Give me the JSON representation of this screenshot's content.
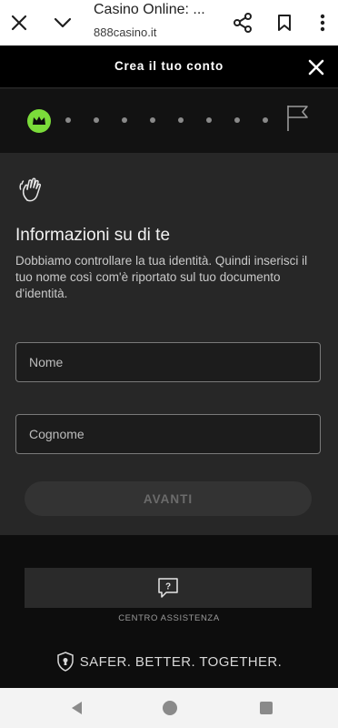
{
  "browser": {
    "title": "Casino Online: ...",
    "url": "888casino.it"
  },
  "dialog": {
    "title": "Crea il tuo conto"
  },
  "progress": {
    "total_steps": 9,
    "current_step": 1,
    "accent_color": "#7bdc3a"
  },
  "form": {
    "heading": "Informazioni su di te",
    "description": "Dobbiamo controllare la tua identità. Quindi inserisci il tuo nome così com'è riportato sul tuo documento d'identità.",
    "first_name": {
      "placeholder": "Nome",
      "value": ""
    },
    "last_name": {
      "placeholder": "Cognome",
      "value": ""
    },
    "submit_label": "AVANTI"
  },
  "footer": {
    "help_label": "CENTRO ASSISTENZA",
    "tagline": "SAFER. BETTER. TOGETHER."
  }
}
